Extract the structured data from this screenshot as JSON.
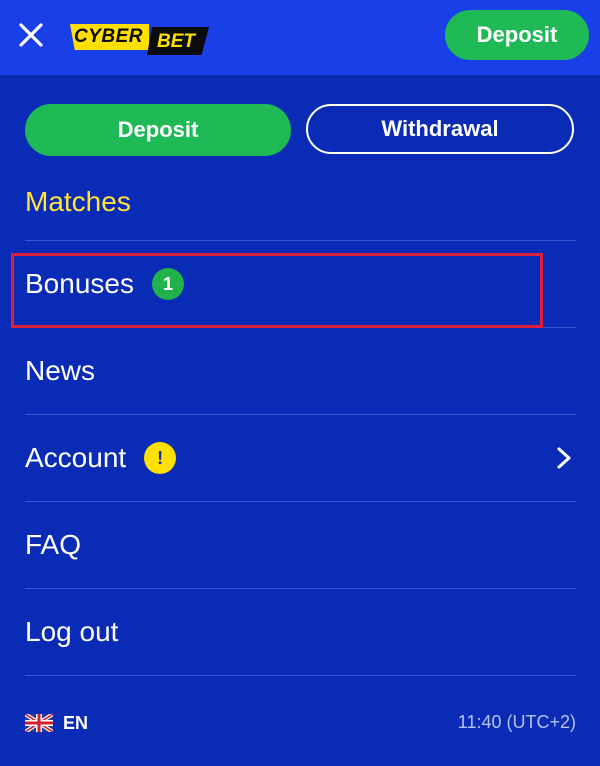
{
  "header": {
    "logo_part1": "CYBER",
    "logo_part2": "BET",
    "deposit_label": "Deposit"
  },
  "actions": {
    "deposit_label": "Deposit",
    "withdrawal_label": "Withdrawal"
  },
  "menu": {
    "items": [
      {
        "label": "Matches",
        "active": true
      },
      {
        "label": "Bonuses",
        "badge": "1",
        "badge_color": "#22b24c"
      },
      {
        "label": "News"
      },
      {
        "label": "Account",
        "badge": "!",
        "badge_color": "#ffe000",
        "chevron": "chevron-right-icon"
      },
      {
        "label": "FAQ"
      },
      {
        "label": "Log out"
      }
    ]
  },
  "footer": {
    "language_code": "EN",
    "flag_icon": "uk-flag-icon",
    "time": "11:40 (UTC+2)"
  },
  "colors": {
    "background": "#0a2bb5",
    "header": "#1940e8",
    "green": "#1fb956",
    "yellow": "#ffe23b",
    "highlight": "#e0203a"
  }
}
